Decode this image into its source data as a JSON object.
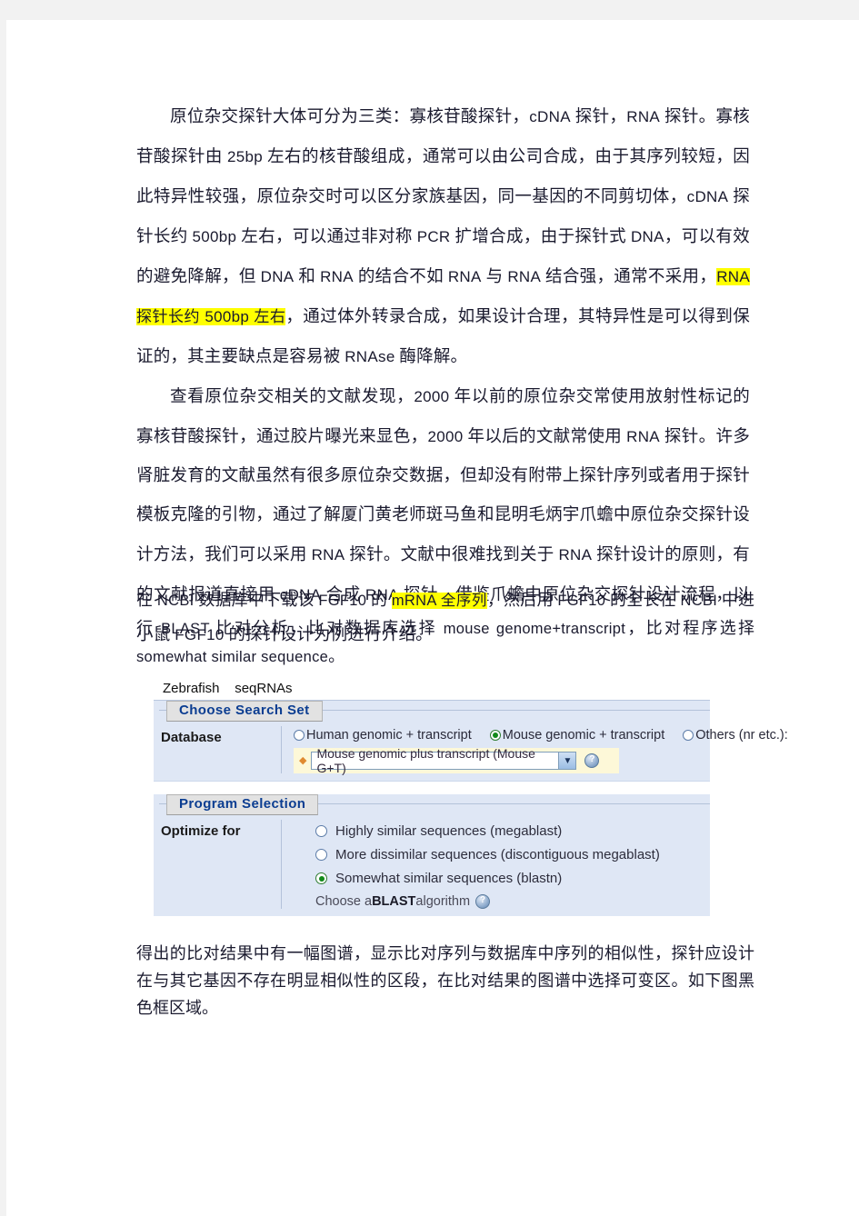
{
  "document": {
    "paragraphs": [
      {
        "id": "p1",
        "indent": true,
        "runs": [
          {
            "t": "cjk",
            "v": "原位杂交探针大体可分为三类："
          },
          {
            "t": "cjk",
            "v": "寡核苷酸探针，"
          },
          {
            "t": "en",
            "v": "cDNA"
          },
          {
            "t": "cjk",
            "v": " 探针，"
          },
          {
            "t": "en",
            "v": "RNA"
          },
          {
            "t": "cjk",
            "v": " 探针。寡核苷酸探针由 "
          },
          {
            "t": "en",
            "v": "25bp"
          },
          {
            "t": "cjk",
            "v": " 左右的核苷酸组成，通常可以由公司合成，由于其序列较短，因此特异性较强，原位杂交时可以区分家族基因，同一基因的不同剪切体，"
          },
          {
            "t": "en",
            "v": "cDNA"
          },
          {
            "t": "cjk",
            "v": " 探针长约 "
          },
          {
            "t": "en",
            "v": "500bp"
          },
          {
            "t": "cjk",
            "v": " 左右，可以通过非对称 "
          },
          {
            "t": "en",
            "v": "PCR"
          },
          {
            "t": "cjk",
            "v": " 扩增合成，由于探针式 "
          },
          {
            "t": "en",
            "v": "DNA"
          },
          {
            "t": "cjk",
            "v": "，可以有效的避免降解，但 "
          },
          {
            "t": "en",
            "v": "DNA"
          },
          {
            "t": "cjk",
            "v": " 和 "
          },
          {
            "t": "en",
            "v": "RNA"
          },
          {
            "t": "cjk",
            "v": " 的结合不如 "
          },
          {
            "t": "en",
            "v": "RNA"
          },
          {
            "t": "cjk",
            "v": " 与 "
          },
          {
            "t": "en",
            "v": "RNA"
          },
          {
            "t": "cjk",
            "v": " 结合强，通常不采用，"
          },
          {
            "t": "hl",
            "v": "RNA 探针长约 500bp 左右"
          },
          {
            "t": "cjk",
            "v": "，通过体外转录合成，如果设计合理，其特异性是可以得到保证的，其主要缺点是容易被 "
          },
          {
            "t": "en",
            "v": "RNAse"
          },
          {
            "t": "cjk",
            "v": " 酶降解。"
          }
        ]
      },
      {
        "id": "p2",
        "indent": true,
        "runs": [
          {
            "t": "cjk",
            "v": "查看原位杂交相关的文献发现，"
          },
          {
            "t": "en",
            "v": "2000"
          },
          {
            "t": "cjk",
            "v": " 年以前的原位杂交常使用放射性标记的寡核苷酸探针，通过胶片曝光来显色，"
          },
          {
            "t": "en",
            "v": "2000"
          },
          {
            "t": "cjk",
            "v": " 年以后的文献常使用 "
          },
          {
            "t": "en",
            "v": "RNA"
          },
          {
            "t": "cjk",
            "v": " 探针。许多肾脏发育的文献虽然有很多原位杂交数据，但却没有附带上探针序列或者用于探针模板克隆的引物，通过了解厦门黄老师斑马鱼和昆明毛炳宇爪蟾中原位杂交探针设计方法，我们可以采用 "
          },
          {
            "t": "en",
            "v": "RNA"
          },
          {
            "t": "cjk",
            "v": " 探针。文献中很难找到关于 "
          },
          {
            "t": "en",
            "v": "RNA"
          },
          {
            "t": "cjk",
            "v": " 探针设计的原则，有的文献报道直接用 "
          },
          {
            "t": "en",
            "v": "cDNA"
          },
          {
            "t": "cjk",
            "v": " 合成 "
          },
          {
            "t": "en",
            "v": "RNA"
          },
          {
            "t": "cjk",
            "v": " 探针。借鉴爪蟾中原位杂交探针设计流程，以小鼠 "
          },
          {
            "t": "en",
            "v": "FGF10"
          },
          {
            "t": "cjk",
            "v": " 的探针设计为例进行介绍。"
          }
        ]
      }
    ],
    "small_paragraph": {
      "id": "p3",
      "runs": [
        {
          "t": "cjk",
          "v": "在 "
        },
        {
          "t": "en",
          "v": "NCBI"
        },
        {
          "t": "cjk",
          "v": " 数据库中下载该 "
        },
        {
          "t": "en",
          "v": "FGF10"
        },
        {
          "t": "cjk",
          "v": " 的 "
        },
        {
          "t": "hl",
          "v": "mRNA 全序列"
        },
        {
          "t": "cjk",
          "v": "，然后用 "
        },
        {
          "t": "en",
          "v": "FGF10"
        },
        {
          "t": "cjk",
          "v": " 的全长在 "
        },
        {
          "t": "en",
          "v": "NCBI"
        },
        {
          "t": "cjk",
          "v": " 中进行 "
        },
        {
          "t": "en",
          "v": "BLAST"
        },
        {
          "t": "cjk",
          "v": " 比对分析，比对数据库选择 "
        },
        {
          "t": "en",
          "v": "mouse genome+transcript"
        },
        {
          "t": "cjk",
          "v": "，比对程序选择 "
        },
        {
          "t": "en",
          "v": "somewhat  similar  sequence"
        },
        {
          "t": "cjk",
          "v": "。"
        }
      ]
    },
    "closing_paragraph": {
      "id": "p4",
      "runs": [
        {
          "t": "cjk",
          "v": "得出的比对结果中有一幅图谱，显示比对序列与数据库中序列的相似性，探针应设计在与其它基因不存在明显相似性的区段，在比对结果的图谱中选择可变区。如下图黑色框区域。"
        }
      ]
    }
  },
  "blast_screenshot": {
    "caption": "Zebrafish    seqRNAs",
    "choose_search_set": {
      "legend": "Choose Search Set",
      "field_label": "Database",
      "radio_options": [
        {
          "label": "Human genomic + transcript",
          "checked": false
        },
        {
          "label": "Mouse genomic + transcript",
          "checked": true
        },
        {
          "label": "Others (nr etc.):",
          "checked": false
        }
      ],
      "select_value": "Mouse genomic plus transcript (Mouse G+T)",
      "select_arrow_glyph": "▼",
      "help_glyph": "?"
    },
    "program_selection": {
      "legend": "Program Selection",
      "field_label": "Optimize for",
      "options": [
        {
          "label": "Highly similar sequences (megablast)",
          "checked": false
        },
        {
          "label": "More dissimilar sequences (discontiguous megablast)",
          "checked": false
        },
        {
          "label": "Somewhat similar sequences (blastn)",
          "checked": true
        }
      ],
      "algorithm_prefix": "Choose a ",
      "algorithm_bold": "BLAST",
      "algorithm_suffix": " algorithm"
    }
  },
  "colors": {
    "page_background": "#f2f2f2",
    "sheet": "#ffffff",
    "highlight": "#ffff00",
    "panel_blue": "#dfe7f5",
    "legend_blue_text": "#0b3d91",
    "yellow_field": "#fdf8d8",
    "radio_green": "#128a19"
  }
}
